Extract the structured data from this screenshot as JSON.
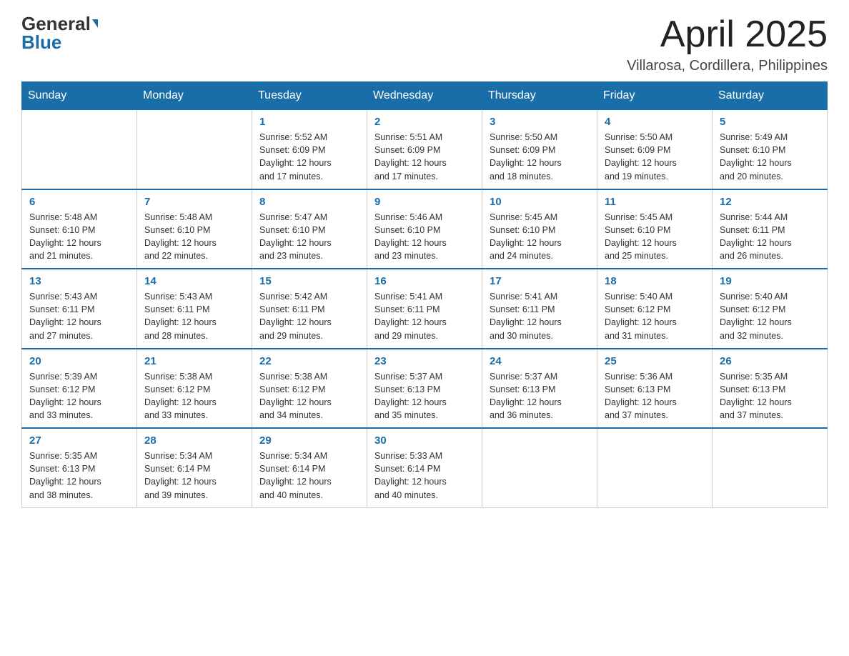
{
  "header": {
    "logo_general": "General",
    "logo_blue": "Blue",
    "month_title": "April 2025",
    "location": "Villarosa, Cordillera, Philippines"
  },
  "weekdays": [
    "Sunday",
    "Monday",
    "Tuesday",
    "Wednesday",
    "Thursday",
    "Friday",
    "Saturday"
  ],
  "weeks": [
    [
      {
        "day": "",
        "info": ""
      },
      {
        "day": "",
        "info": ""
      },
      {
        "day": "1",
        "info": "Sunrise: 5:52 AM\nSunset: 6:09 PM\nDaylight: 12 hours\nand 17 minutes."
      },
      {
        "day": "2",
        "info": "Sunrise: 5:51 AM\nSunset: 6:09 PM\nDaylight: 12 hours\nand 17 minutes."
      },
      {
        "day": "3",
        "info": "Sunrise: 5:50 AM\nSunset: 6:09 PM\nDaylight: 12 hours\nand 18 minutes."
      },
      {
        "day": "4",
        "info": "Sunrise: 5:50 AM\nSunset: 6:09 PM\nDaylight: 12 hours\nand 19 minutes."
      },
      {
        "day": "5",
        "info": "Sunrise: 5:49 AM\nSunset: 6:10 PM\nDaylight: 12 hours\nand 20 minutes."
      }
    ],
    [
      {
        "day": "6",
        "info": "Sunrise: 5:48 AM\nSunset: 6:10 PM\nDaylight: 12 hours\nand 21 minutes."
      },
      {
        "day": "7",
        "info": "Sunrise: 5:48 AM\nSunset: 6:10 PM\nDaylight: 12 hours\nand 22 minutes."
      },
      {
        "day": "8",
        "info": "Sunrise: 5:47 AM\nSunset: 6:10 PM\nDaylight: 12 hours\nand 23 minutes."
      },
      {
        "day": "9",
        "info": "Sunrise: 5:46 AM\nSunset: 6:10 PM\nDaylight: 12 hours\nand 23 minutes."
      },
      {
        "day": "10",
        "info": "Sunrise: 5:45 AM\nSunset: 6:10 PM\nDaylight: 12 hours\nand 24 minutes."
      },
      {
        "day": "11",
        "info": "Sunrise: 5:45 AM\nSunset: 6:10 PM\nDaylight: 12 hours\nand 25 minutes."
      },
      {
        "day": "12",
        "info": "Sunrise: 5:44 AM\nSunset: 6:11 PM\nDaylight: 12 hours\nand 26 minutes."
      }
    ],
    [
      {
        "day": "13",
        "info": "Sunrise: 5:43 AM\nSunset: 6:11 PM\nDaylight: 12 hours\nand 27 minutes."
      },
      {
        "day": "14",
        "info": "Sunrise: 5:43 AM\nSunset: 6:11 PM\nDaylight: 12 hours\nand 28 minutes."
      },
      {
        "day": "15",
        "info": "Sunrise: 5:42 AM\nSunset: 6:11 PM\nDaylight: 12 hours\nand 29 minutes."
      },
      {
        "day": "16",
        "info": "Sunrise: 5:41 AM\nSunset: 6:11 PM\nDaylight: 12 hours\nand 29 minutes."
      },
      {
        "day": "17",
        "info": "Sunrise: 5:41 AM\nSunset: 6:11 PM\nDaylight: 12 hours\nand 30 minutes."
      },
      {
        "day": "18",
        "info": "Sunrise: 5:40 AM\nSunset: 6:12 PM\nDaylight: 12 hours\nand 31 minutes."
      },
      {
        "day": "19",
        "info": "Sunrise: 5:40 AM\nSunset: 6:12 PM\nDaylight: 12 hours\nand 32 minutes."
      }
    ],
    [
      {
        "day": "20",
        "info": "Sunrise: 5:39 AM\nSunset: 6:12 PM\nDaylight: 12 hours\nand 33 minutes."
      },
      {
        "day": "21",
        "info": "Sunrise: 5:38 AM\nSunset: 6:12 PM\nDaylight: 12 hours\nand 33 minutes."
      },
      {
        "day": "22",
        "info": "Sunrise: 5:38 AM\nSunset: 6:12 PM\nDaylight: 12 hours\nand 34 minutes."
      },
      {
        "day": "23",
        "info": "Sunrise: 5:37 AM\nSunset: 6:13 PM\nDaylight: 12 hours\nand 35 minutes."
      },
      {
        "day": "24",
        "info": "Sunrise: 5:37 AM\nSunset: 6:13 PM\nDaylight: 12 hours\nand 36 minutes."
      },
      {
        "day": "25",
        "info": "Sunrise: 5:36 AM\nSunset: 6:13 PM\nDaylight: 12 hours\nand 37 minutes."
      },
      {
        "day": "26",
        "info": "Sunrise: 5:35 AM\nSunset: 6:13 PM\nDaylight: 12 hours\nand 37 minutes."
      }
    ],
    [
      {
        "day": "27",
        "info": "Sunrise: 5:35 AM\nSunset: 6:13 PM\nDaylight: 12 hours\nand 38 minutes."
      },
      {
        "day": "28",
        "info": "Sunrise: 5:34 AM\nSunset: 6:14 PM\nDaylight: 12 hours\nand 39 minutes."
      },
      {
        "day": "29",
        "info": "Sunrise: 5:34 AM\nSunset: 6:14 PM\nDaylight: 12 hours\nand 40 minutes."
      },
      {
        "day": "30",
        "info": "Sunrise: 5:33 AM\nSunset: 6:14 PM\nDaylight: 12 hours\nand 40 minutes."
      },
      {
        "day": "",
        "info": ""
      },
      {
        "day": "",
        "info": ""
      },
      {
        "day": "",
        "info": ""
      }
    ]
  ]
}
